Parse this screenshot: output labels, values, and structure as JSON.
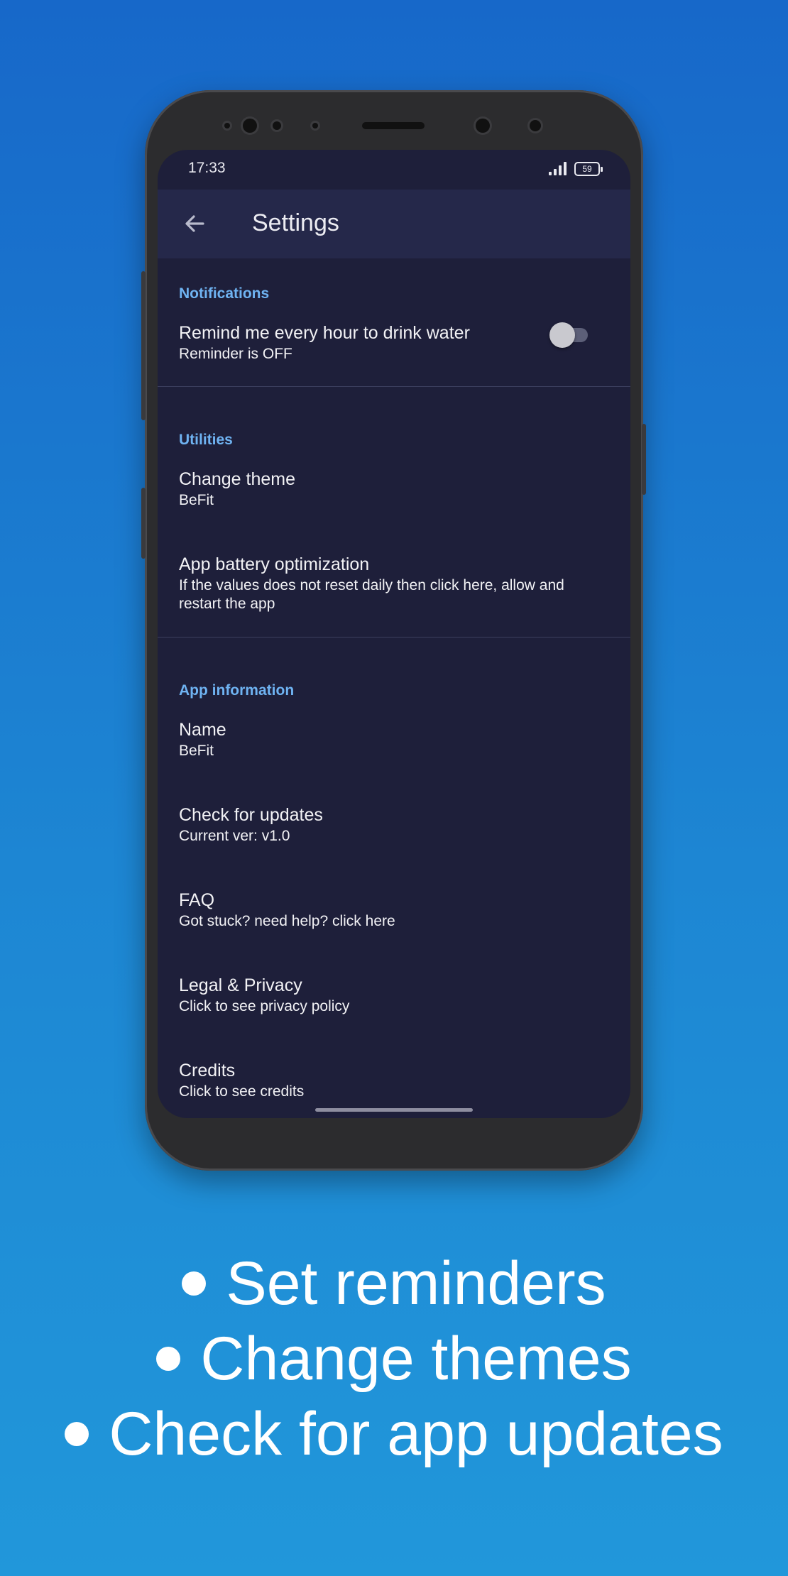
{
  "status_bar": {
    "time": "17:33",
    "battery": "59"
  },
  "app_bar": {
    "title": "Settings",
    "back_icon": "arrow-back-icon"
  },
  "sections": {
    "notifications": {
      "header": "Notifications",
      "reminder": {
        "title": "Remind me every hour to drink water",
        "subtitle": "Reminder is OFF",
        "toggle_on": false
      }
    },
    "utilities": {
      "header": "Utilities",
      "theme": {
        "title": "Change theme",
        "subtitle": "BeFit"
      },
      "battery": {
        "title": "App battery optimization",
        "subtitle": "If the values does not reset daily then click here, allow and restart the app"
      }
    },
    "app_information": {
      "header": "App information",
      "name": {
        "title": "Name",
        "subtitle": "BeFit"
      },
      "updates": {
        "title": "Check for updates",
        "subtitle": "Current ver: v1.0"
      },
      "faq": {
        "title": "FAQ",
        "subtitle": "Got stuck? need help? click here"
      },
      "legal": {
        "title": "Legal & Privacy",
        "subtitle": "Click to see privacy policy"
      },
      "credits": {
        "title": "Credits",
        "subtitle": "Click to see credits"
      }
    }
  },
  "captions": [
    "Set reminders",
    "Change themes",
    "Check for app updates"
  ],
  "colors": {
    "background": "#1d86d3",
    "screen": "#1e1f3a",
    "app_bar": "#25284a",
    "accent": "#6fb3f2"
  }
}
